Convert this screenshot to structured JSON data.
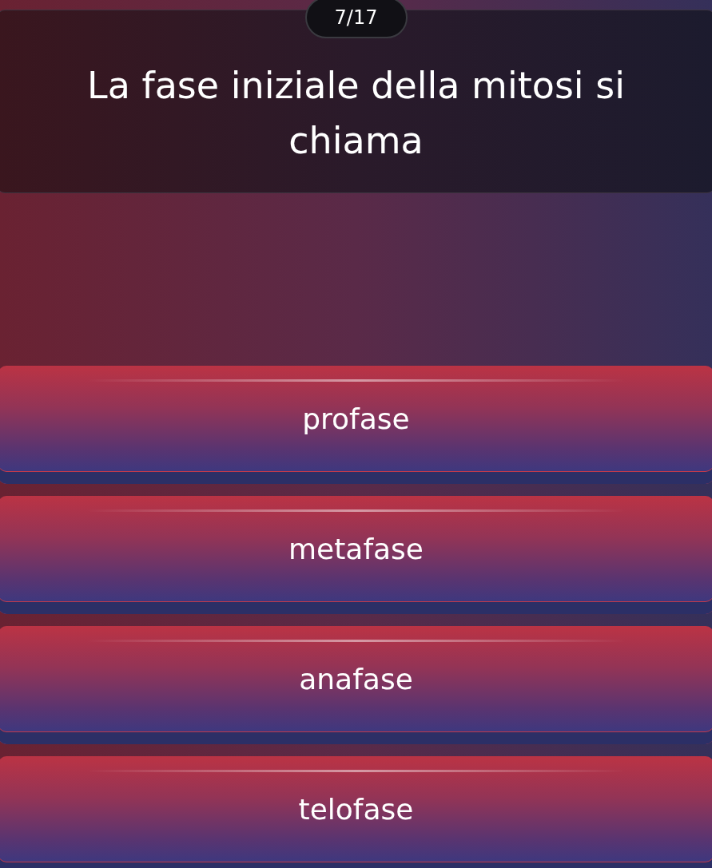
{
  "counter": "7/17",
  "question": "La fase iniziale della mitosi si chiama",
  "answers": [
    {
      "label": "profase"
    },
    {
      "label": "metafase"
    },
    {
      "label": "anafase"
    },
    {
      "label": "telofase"
    }
  ]
}
